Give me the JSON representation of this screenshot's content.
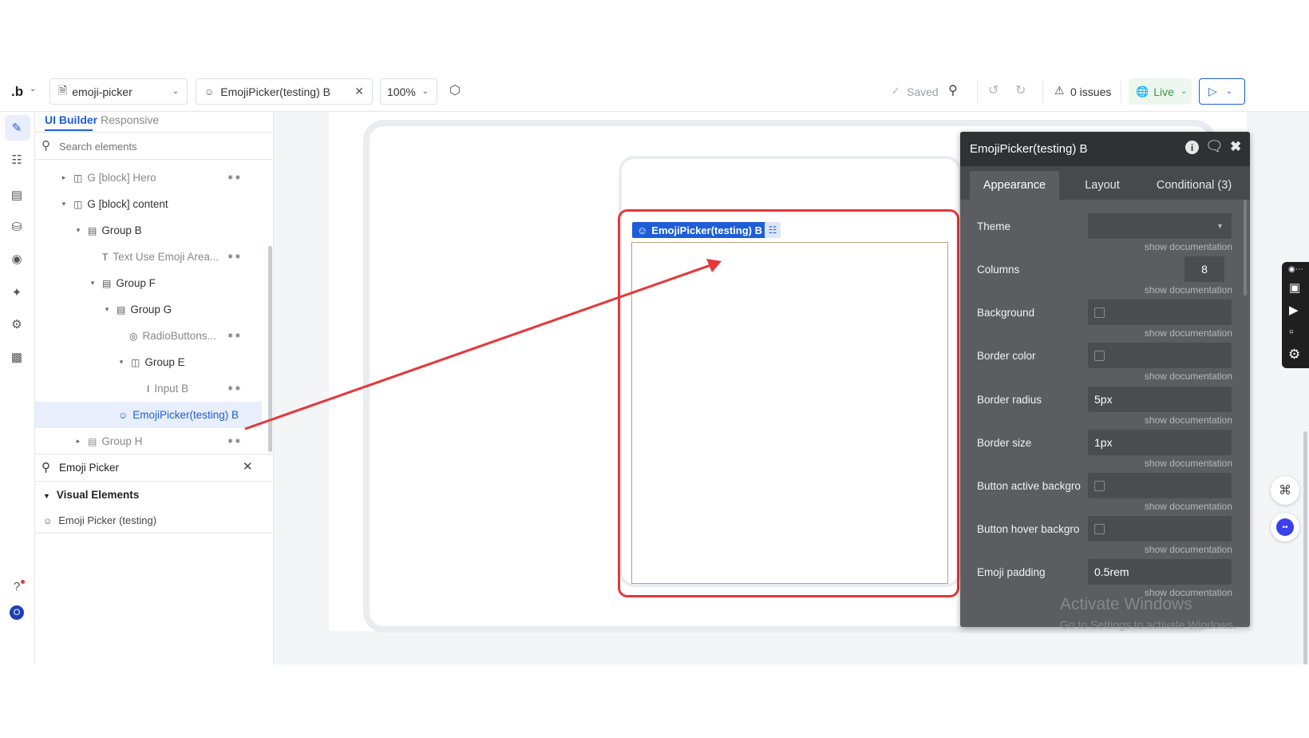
{
  "topbar": {
    "logo": ".b",
    "app_name": "emoji-picker",
    "element_tab": "EmojiPicker(testing) B",
    "zoom": "100%",
    "saved": "Saved",
    "issues": "0 issues",
    "live": "Live"
  },
  "left_panel": {
    "tabs": [
      "UI Builder",
      "Responsive"
    ],
    "search_placeholder": "Search elements",
    "tree": [
      {
        "label": "G [block] Hero",
        "icon": "column-group-icon"
      },
      {
        "label": "G [block] content",
        "icon": "column-group-icon"
      },
      {
        "label": "Group B",
        "icon": "row-group-icon"
      },
      {
        "label": "Text Use Emoji Area...",
        "icon": "text-icon"
      },
      {
        "label": "Group F",
        "icon": "row-group-icon"
      },
      {
        "label": "Group G",
        "icon": "row-group-icon"
      },
      {
        "label": "RadioButtons...",
        "icon": "radio-icon"
      },
      {
        "label": "Group E",
        "icon": "column-group-icon"
      },
      {
        "label": "Input B",
        "icon": "input-icon"
      },
      {
        "label": "EmojiPicker(testing) B",
        "icon": "emoji-icon"
      },
      {
        "label": "Group H",
        "icon": "row-group-icon"
      }
    ],
    "palette_search_value": "Emoji Picker",
    "palette_section": "Visual Elements",
    "palette_item": "Emoji Picker (testing)"
  },
  "canvas": {
    "element_label": "EmojiPicker(testing) B"
  },
  "editor": {
    "title": "EmojiPicker(testing) B",
    "tabs": [
      "Appearance",
      "Layout",
      "Conditional (3)"
    ],
    "doc_link": "show documentation",
    "props": [
      {
        "label": "Theme",
        "value": ""
      },
      {
        "label": "Columns",
        "value": "8"
      },
      {
        "label": "Background",
        "value": ""
      },
      {
        "label": "Border color",
        "value": ""
      },
      {
        "label": "Border radius",
        "value": "5px"
      },
      {
        "label": "Border size",
        "value": "1px"
      },
      {
        "label": "Button active backgro",
        "value": ""
      },
      {
        "label": "Button hover backgro",
        "value": ""
      },
      {
        "label": "Emoji padding",
        "value": "0.5rem"
      }
    ]
  },
  "watermark": {
    "title": "Activate Windows",
    "subtitle": "Go to Settings to activate Windows."
  },
  "colors": {
    "accent": "#1d5ed8",
    "highlight_red": "#e5383b",
    "editor_bg": "#5b5d61"
  }
}
